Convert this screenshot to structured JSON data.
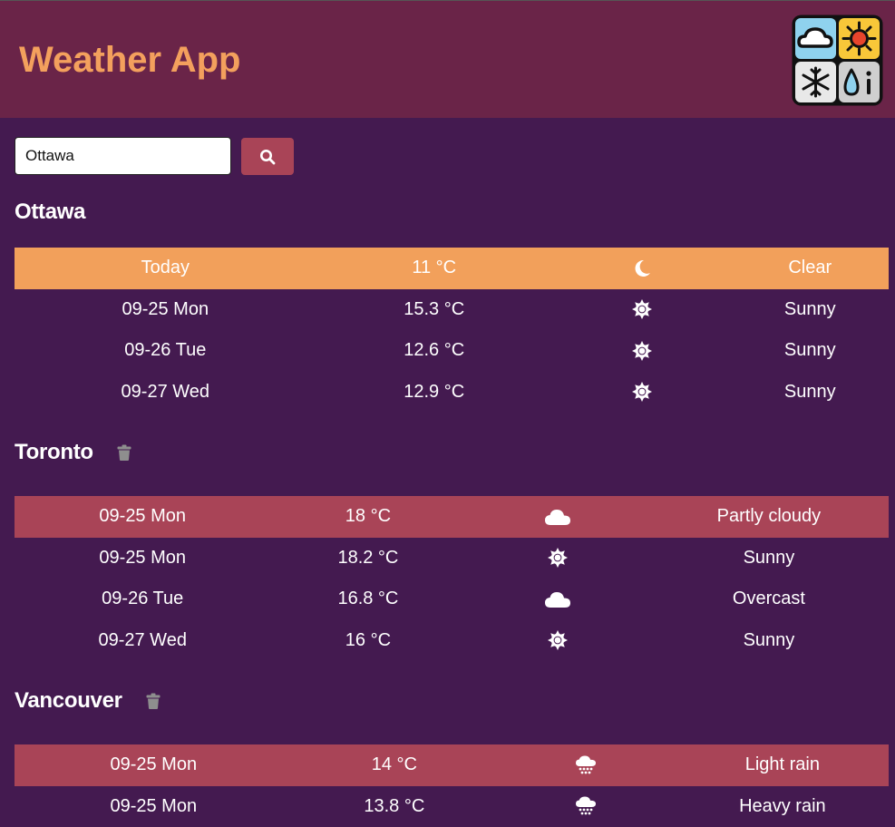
{
  "app": {
    "title": "Weather App"
  },
  "search": {
    "value": "Ottawa",
    "placeholder": ""
  },
  "cities": [
    {
      "name": "Ottawa",
      "deletable": false,
      "columns": [
        34.5,
        27,
        20.5,
        18
      ],
      "rows": [
        {
          "date": "Today",
          "temp": "11 °C",
          "icon": "moon-icon",
          "condition": "Clear",
          "highlight": "#f2a05b"
        },
        {
          "date": "09-25 Mon",
          "temp": "15.3 °C",
          "icon": "sun-icon",
          "condition": "Sunny"
        },
        {
          "date": "09-26 Tue",
          "temp": "12.6 °C",
          "icon": "sun-icon",
          "condition": "Sunny"
        },
        {
          "date": "09-27 Wed",
          "temp": "12.9 °C",
          "icon": "sun-icon",
          "condition": "Sunny"
        }
      ]
    },
    {
      "name": "Toronto",
      "deletable": true,
      "columns": [
        29.3,
        22.3,
        21,
        27.4
      ],
      "rows": [
        {
          "date": "09-25 Mon",
          "temp": "18 °C",
          "icon": "cloud-icon",
          "condition": "Partly cloudy",
          "highlight": "#a94457"
        },
        {
          "date": "09-25 Mon",
          "temp": "18.2 °C",
          "icon": "sun-icon",
          "condition": "Sunny"
        },
        {
          "date": "09-26 Tue",
          "temp": "16.8 °C",
          "icon": "cloud-icon",
          "condition": "Overcast"
        },
        {
          "date": "09-27 Wed",
          "temp": "16 °C",
          "icon": "sun-icon",
          "condition": "Sunny"
        }
      ]
    },
    {
      "name": "Vancouver",
      "deletable": true,
      "columns": [
        31.8,
        23.3,
        20.6,
        24.3
      ],
      "rows": [
        {
          "date": "09-25 Mon",
          "temp": "14 °C",
          "icon": "rain-cloud-icon",
          "condition": "Light rain",
          "highlight": "#a94457"
        },
        {
          "date": "09-25 Mon",
          "temp": "13.8 °C",
          "icon": "rain-cloud-icon",
          "condition": "Heavy rain"
        }
      ]
    }
  ],
  "colors": {
    "background": "#441a50",
    "header": "#6a2448",
    "title": "#f3a05d",
    "today_row": "#f2a05b",
    "city_first_row": "#a94457",
    "search_button": "#a94457"
  }
}
